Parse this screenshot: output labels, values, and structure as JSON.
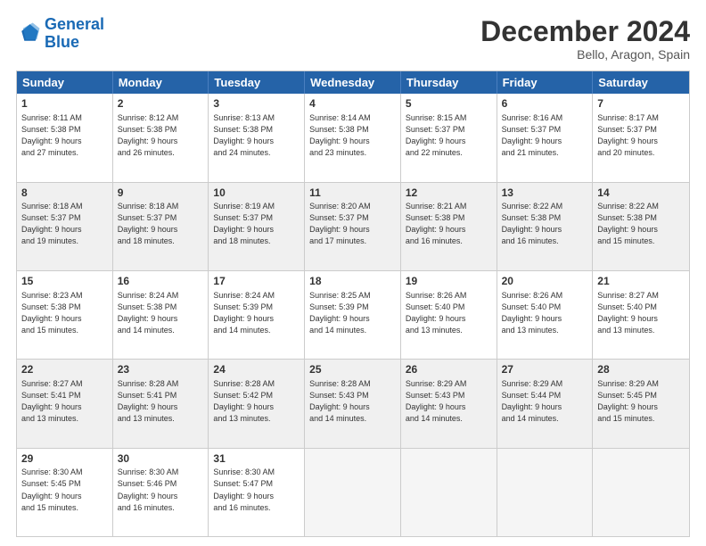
{
  "header": {
    "logo_line1": "General",
    "logo_line2": "Blue",
    "month_title": "December 2024",
    "subtitle": "Bello, Aragon, Spain"
  },
  "days_of_week": [
    "Sunday",
    "Monday",
    "Tuesday",
    "Wednesday",
    "Thursday",
    "Friday",
    "Saturday"
  ],
  "weeks": [
    [
      {
        "num": "1",
        "lines": [
          "Sunrise: 8:11 AM",
          "Sunset: 5:38 PM",
          "Daylight: 9 hours",
          "and 27 minutes."
        ],
        "shaded": false
      },
      {
        "num": "2",
        "lines": [
          "Sunrise: 8:12 AM",
          "Sunset: 5:38 PM",
          "Daylight: 9 hours",
          "and 26 minutes."
        ],
        "shaded": false
      },
      {
        "num": "3",
        "lines": [
          "Sunrise: 8:13 AM",
          "Sunset: 5:38 PM",
          "Daylight: 9 hours",
          "and 24 minutes."
        ],
        "shaded": false
      },
      {
        "num": "4",
        "lines": [
          "Sunrise: 8:14 AM",
          "Sunset: 5:38 PM",
          "Daylight: 9 hours",
          "and 23 minutes."
        ],
        "shaded": false
      },
      {
        "num": "5",
        "lines": [
          "Sunrise: 8:15 AM",
          "Sunset: 5:37 PM",
          "Daylight: 9 hours",
          "and 22 minutes."
        ],
        "shaded": false
      },
      {
        "num": "6",
        "lines": [
          "Sunrise: 8:16 AM",
          "Sunset: 5:37 PM",
          "Daylight: 9 hours",
          "and 21 minutes."
        ],
        "shaded": false
      },
      {
        "num": "7",
        "lines": [
          "Sunrise: 8:17 AM",
          "Sunset: 5:37 PM",
          "Daylight: 9 hours",
          "and 20 minutes."
        ],
        "shaded": false
      }
    ],
    [
      {
        "num": "8",
        "lines": [
          "Sunrise: 8:18 AM",
          "Sunset: 5:37 PM",
          "Daylight: 9 hours",
          "and 19 minutes."
        ],
        "shaded": true
      },
      {
        "num": "9",
        "lines": [
          "Sunrise: 8:18 AM",
          "Sunset: 5:37 PM",
          "Daylight: 9 hours",
          "and 18 minutes."
        ],
        "shaded": true
      },
      {
        "num": "10",
        "lines": [
          "Sunrise: 8:19 AM",
          "Sunset: 5:37 PM",
          "Daylight: 9 hours",
          "and 18 minutes."
        ],
        "shaded": true
      },
      {
        "num": "11",
        "lines": [
          "Sunrise: 8:20 AM",
          "Sunset: 5:37 PM",
          "Daylight: 9 hours",
          "and 17 minutes."
        ],
        "shaded": true
      },
      {
        "num": "12",
        "lines": [
          "Sunrise: 8:21 AM",
          "Sunset: 5:38 PM",
          "Daylight: 9 hours",
          "and 16 minutes."
        ],
        "shaded": true
      },
      {
        "num": "13",
        "lines": [
          "Sunrise: 8:22 AM",
          "Sunset: 5:38 PM",
          "Daylight: 9 hours",
          "and 16 minutes."
        ],
        "shaded": true
      },
      {
        "num": "14",
        "lines": [
          "Sunrise: 8:22 AM",
          "Sunset: 5:38 PM",
          "Daylight: 9 hours",
          "and 15 minutes."
        ],
        "shaded": true
      }
    ],
    [
      {
        "num": "15",
        "lines": [
          "Sunrise: 8:23 AM",
          "Sunset: 5:38 PM",
          "Daylight: 9 hours",
          "and 15 minutes."
        ],
        "shaded": false
      },
      {
        "num": "16",
        "lines": [
          "Sunrise: 8:24 AM",
          "Sunset: 5:38 PM",
          "Daylight: 9 hours",
          "and 14 minutes."
        ],
        "shaded": false
      },
      {
        "num": "17",
        "lines": [
          "Sunrise: 8:24 AM",
          "Sunset: 5:39 PM",
          "Daylight: 9 hours",
          "and 14 minutes."
        ],
        "shaded": false
      },
      {
        "num": "18",
        "lines": [
          "Sunrise: 8:25 AM",
          "Sunset: 5:39 PM",
          "Daylight: 9 hours",
          "and 14 minutes."
        ],
        "shaded": false
      },
      {
        "num": "19",
        "lines": [
          "Sunrise: 8:26 AM",
          "Sunset: 5:40 PM",
          "Daylight: 9 hours",
          "and 13 minutes."
        ],
        "shaded": false
      },
      {
        "num": "20",
        "lines": [
          "Sunrise: 8:26 AM",
          "Sunset: 5:40 PM",
          "Daylight: 9 hours",
          "and 13 minutes."
        ],
        "shaded": false
      },
      {
        "num": "21",
        "lines": [
          "Sunrise: 8:27 AM",
          "Sunset: 5:40 PM",
          "Daylight: 9 hours",
          "and 13 minutes."
        ],
        "shaded": false
      }
    ],
    [
      {
        "num": "22",
        "lines": [
          "Sunrise: 8:27 AM",
          "Sunset: 5:41 PM",
          "Daylight: 9 hours",
          "and 13 minutes."
        ],
        "shaded": true
      },
      {
        "num": "23",
        "lines": [
          "Sunrise: 8:28 AM",
          "Sunset: 5:41 PM",
          "Daylight: 9 hours",
          "and 13 minutes."
        ],
        "shaded": true
      },
      {
        "num": "24",
        "lines": [
          "Sunrise: 8:28 AM",
          "Sunset: 5:42 PM",
          "Daylight: 9 hours",
          "and 13 minutes."
        ],
        "shaded": true
      },
      {
        "num": "25",
        "lines": [
          "Sunrise: 8:28 AM",
          "Sunset: 5:43 PM",
          "Daylight: 9 hours",
          "and 14 minutes."
        ],
        "shaded": true
      },
      {
        "num": "26",
        "lines": [
          "Sunrise: 8:29 AM",
          "Sunset: 5:43 PM",
          "Daylight: 9 hours",
          "and 14 minutes."
        ],
        "shaded": true
      },
      {
        "num": "27",
        "lines": [
          "Sunrise: 8:29 AM",
          "Sunset: 5:44 PM",
          "Daylight: 9 hours",
          "and 14 minutes."
        ],
        "shaded": true
      },
      {
        "num": "28",
        "lines": [
          "Sunrise: 8:29 AM",
          "Sunset: 5:45 PM",
          "Daylight: 9 hours",
          "and 15 minutes."
        ],
        "shaded": true
      }
    ],
    [
      {
        "num": "29",
        "lines": [
          "Sunrise: 8:30 AM",
          "Sunset: 5:45 PM",
          "Daylight: 9 hours",
          "and 15 minutes."
        ],
        "shaded": false
      },
      {
        "num": "30",
        "lines": [
          "Sunrise: 8:30 AM",
          "Sunset: 5:46 PM",
          "Daylight: 9 hours",
          "and 16 minutes."
        ],
        "shaded": false
      },
      {
        "num": "31",
        "lines": [
          "Sunrise: 8:30 AM",
          "Sunset: 5:47 PM",
          "Daylight: 9 hours",
          "and 16 minutes."
        ],
        "shaded": false
      },
      {
        "num": "",
        "lines": [],
        "shaded": false,
        "empty": true
      },
      {
        "num": "",
        "lines": [],
        "shaded": false,
        "empty": true
      },
      {
        "num": "",
        "lines": [],
        "shaded": false,
        "empty": true
      },
      {
        "num": "",
        "lines": [],
        "shaded": false,
        "empty": true
      }
    ]
  ]
}
